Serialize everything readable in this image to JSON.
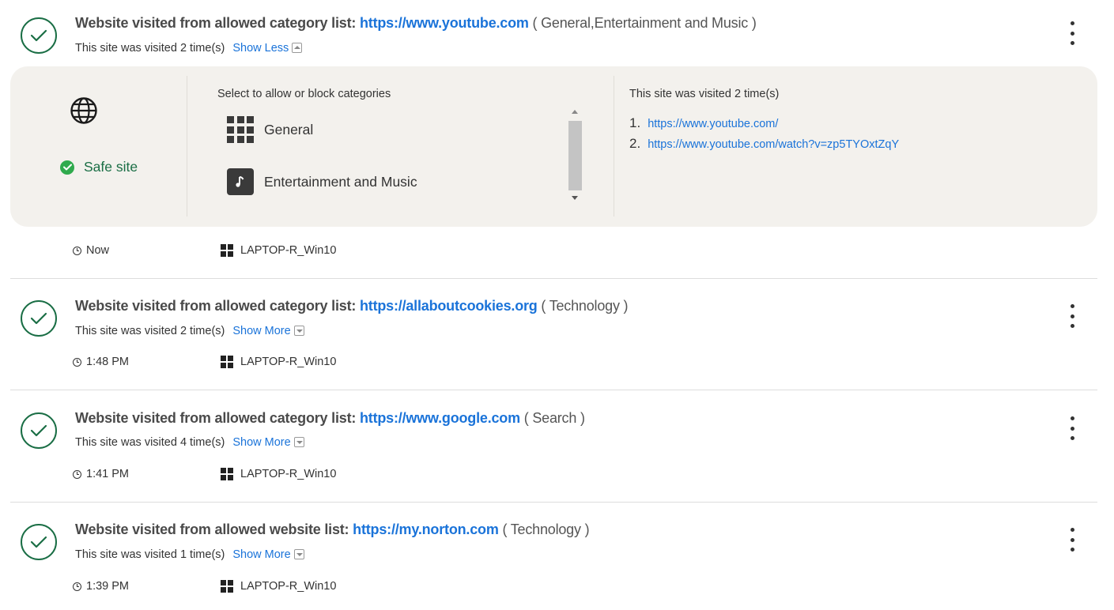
{
  "entries": [
    {
      "title_prefix": "Website visited from allowed category list:",
      "url": "https://www.youtube.com",
      "categories": "( General,Entertainment and Music )",
      "visits": "This site was visited 2 time(s)",
      "toggle": "Show Less",
      "time": "Now",
      "device": "LAPTOP-R_Win10"
    },
    {
      "title_prefix": "Website visited from allowed category list:",
      "url": "https://allaboutcookies.org",
      "categories": "( Technology )",
      "visits": "This site was visited 2 time(s)",
      "toggle": "Show More",
      "time": "1:48 PM",
      "device": "LAPTOP-R_Win10"
    },
    {
      "title_prefix": "Website visited from allowed category list:",
      "url": "https://www.google.com",
      "categories": "( Search )",
      "visits": "This site was visited 4 time(s)",
      "toggle": "Show More",
      "time": "1:41 PM",
      "device": "LAPTOP-R_Win10"
    },
    {
      "title_prefix": "Website visited from allowed website list:",
      "url": "https://my.norton.com",
      "categories": "( Technology )",
      "visits": "This site was visited 1 time(s)",
      "toggle": "Show More",
      "time": "1:39 PM",
      "device": "LAPTOP-R_Win10"
    }
  ],
  "details": {
    "status": "Safe site",
    "categories_heading": "Select to allow or block categories",
    "categories": [
      {
        "label": "General",
        "icon": "grid-icon"
      },
      {
        "label": "Entertainment and Music",
        "icon": "music-note-icon"
      }
    ],
    "visited_heading": "This site was visited 2 time(s)",
    "visited_urls": [
      {
        "num": "1.",
        "url": "https://www.youtube.com/"
      },
      {
        "num": "2.",
        "url": "https://www.youtube.com/watch?v=zp5TYOxtZqY"
      }
    ]
  },
  "colors": {
    "accent_link": "#1a73d9",
    "check_green": "#1a6e45",
    "safe_green": "#2faa4d",
    "panel_bg": "#f3f1ed"
  }
}
